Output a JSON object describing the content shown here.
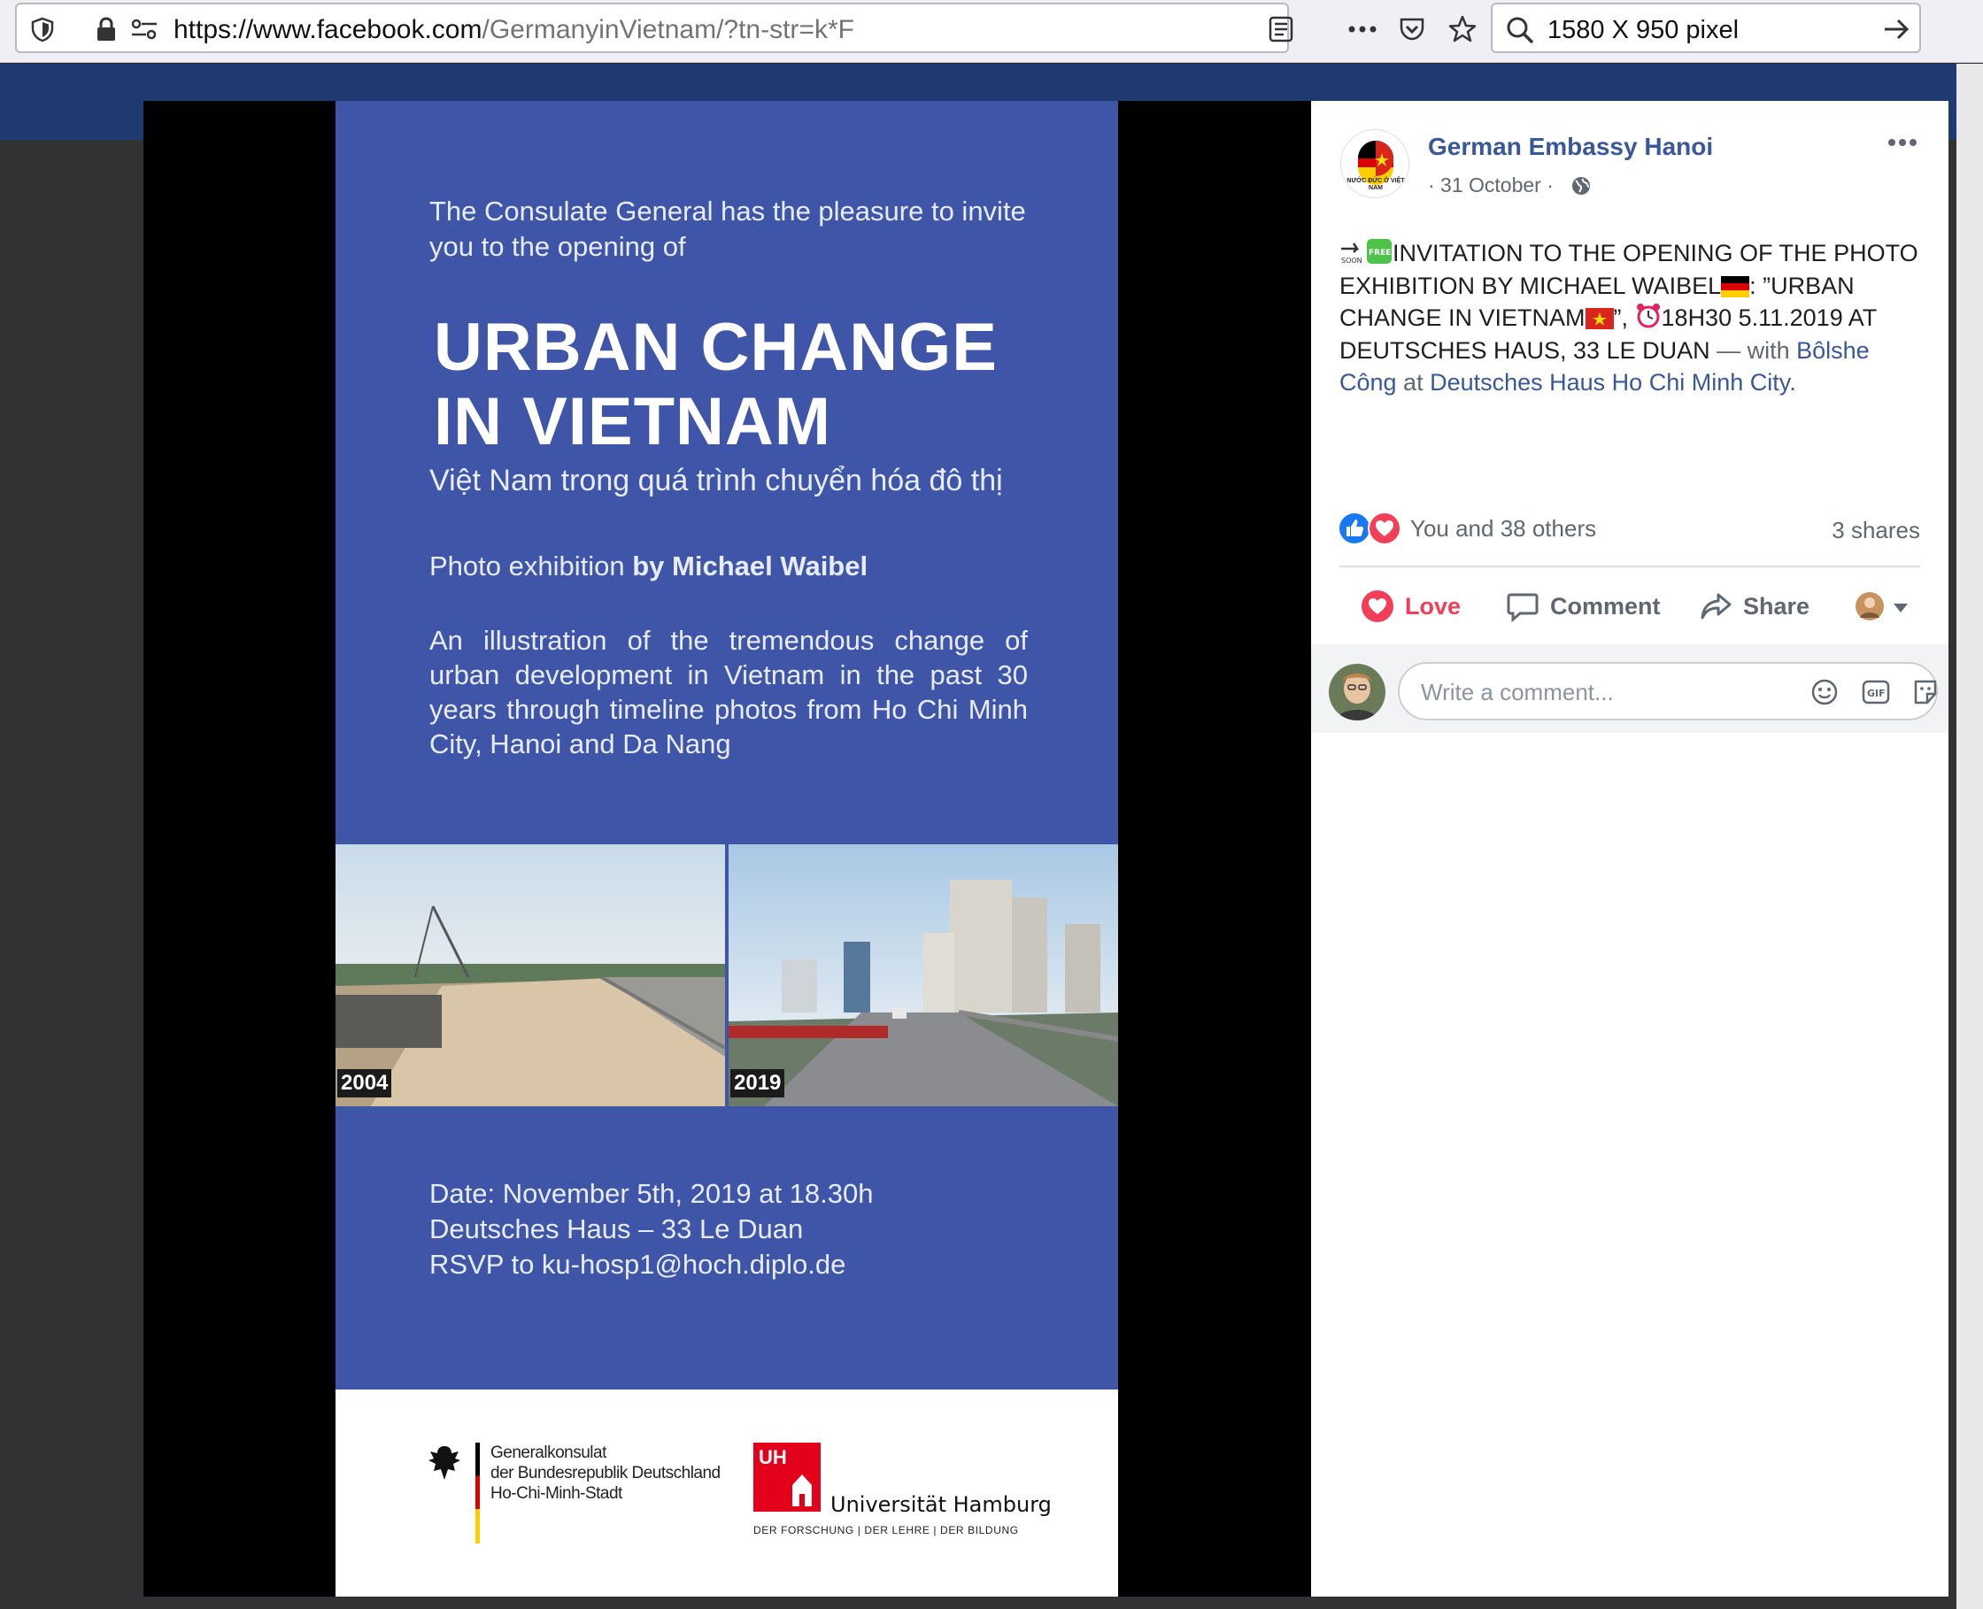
{
  "browser": {
    "url_host": "https://www.facebook.com",
    "url_path": "/GermanyinVietnam/?tn-str=k*F",
    "search_query": "1580 X 950 pixel"
  },
  "poster": {
    "invite": "The Consulate General has the pleasure to invite you to the opening of",
    "title_line1": "URBAN CHANGE",
    "title_line2": "IN VIETNAM",
    "vietnamese": "Việt Nam trong quá trình chuyển hóa đô thị",
    "photo_prefix": "Photo exhibition",
    "photo_by": "by Michael Waibel",
    "description": "An illustration of the tremendous change of urban development in Vietnam in the past 30 years through timeline photos from Ho Chi Minh City, Hanoi and Da Nang",
    "year1": "2004",
    "year2": "2019",
    "date_line": "Date: November 5th, 2019 at 18.30h",
    "venue_line": "Deutsches Haus – 33 Le Duan",
    "rsvp_line": "RSVP to ku-hosp1@hoch.diplo.de",
    "consulate_line1": "Generalkonsulat",
    "consulate_line2": "der Bundesrepublik Deutschland",
    "consulate_line3": "Ho-Chi-Minh-Stadt",
    "uhh_abbr": "UH",
    "uni_name": "Universität Hamburg",
    "uni_tagline": "DER FORSCHUNG | DER LEHRE | DER BILDUNG"
  },
  "post": {
    "page_avatar_text": "NƯỚC ĐỨC Ở VIỆT NAM",
    "page_name": "German Embassy Hanoi",
    "date": "· 31 October ·",
    "soon_label": "SOON",
    "free_label": "FREE",
    "text_1": "INVITATION TO THE OPENING OF THE PHOTO EXHIBITION BY MICHAEL WAIBEL",
    "text_2": ": ”URBAN CHANGE IN VIETNAM",
    "text_3": "”, ",
    "text_4": "18H30 5.11.2019 AT DEUTSCHES HAUS, 33 LE DUAN",
    "text_dash": " — with ",
    "tag_person": "Bôlshe Công",
    "text_at": " at ",
    "tag_place": "Deutsches Haus Ho Chi Minh City",
    "text_end": ".",
    "reactions_text": "You and 38 others",
    "shares": "3 shares",
    "action_love": "Love",
    "action_comment": "Comment",
    "action_share": "Share",
    "comment_placeholder": "Write a comment...",
    "gif_label": "GIF"
  },
  "colors": {
    "poster_blue": "#3f55a8",
    "fb_link": "#385898",
    "love": "#f33e58"
  }
}
